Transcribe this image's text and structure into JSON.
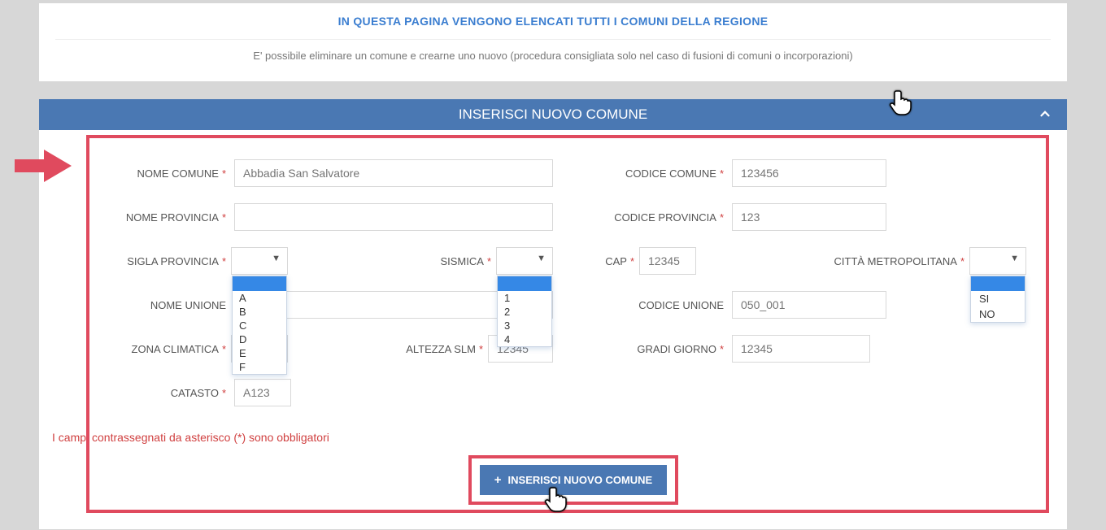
{
  "header": {
    "title": "IN QUESTA PAGINA VENGONO ELENCATI TUTTI I COMUNI DELLA REGIONE",
    "subtitle": "E' possibile eliminare un comune e crearne uno nuovo (procedura consigliata solo nel caso di fusioni di comuni o incorporazioni)",
    "accordion_title": "INSERISCI NUOVO COMUNE"
  },
  "labels": {
    "nome_comune": "NOME COMUNE",
    "codice_comune": "CODICE COMUNE",
    "nome_provincia": "NOME PROVINCIA",
    "codice_provincia": "CODICE PROVINCIA",
    "sigla_provincia": "SIGLA PROVINCIA",
    "sismica": "SISMICA",
    "cap": "CAP",
    "citta_metro": "CITTÀ METROPOLITANA",
    "nome_unione": "NOME UNIONE",
    "codice_unione": "CODICE UNIONE",
    "zona_climatica": "ZONA CLIMATICA",
    "altezza_slm": "ALTEZZA SLM",
    "gradi_giorno": "GRADI GIORNO",
    "catasto": "CATASTO"
  },
  "placeholders": {
    "nome_comune": "Abbadia San Salvatore",
    "codice_comune": "123456",
    "codice_provincia": "123",
    "cap": "12345",
    "codice_unione": "050_001",
    "altezza_slm": "12345",
    "gradi_giorno": "12345",
    "catasto": "A123"
  },
  "dropdowns": {
    "sigla_options": [
      "A",
      "B",
      "C",
      "D",
      "E",
      "F"
    ],
    "sismica_options": [
      "1",
      "2",
      "3",
      "4"
    ],
    "metro_options": [
      "SI",
      "NO"
    ]
  },
  "hint": "I campi contrassegnati da asterisco (*) sono obbligatori",
  "submit_label": "INSERISCI NUOVO COMUNE"
}
